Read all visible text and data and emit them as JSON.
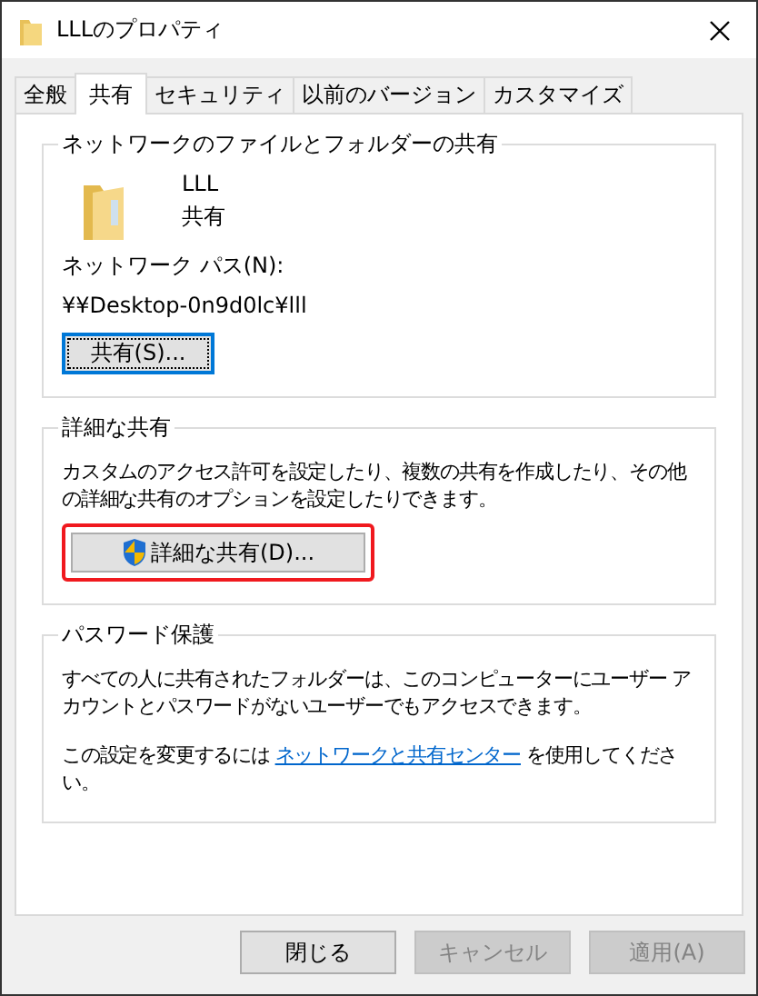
{
  "window": {
    "title": "LLLのプロパティ"
  },
  "tabs": [
    {
      "label": "全般",
      "selected": false
    },
    {
      "label": "共有",
      "selected": true
    },
    {
      "label": "セキュリティ",
      "selected": false
    },
    {
      "label": "以前のバージョン",
      "selected": false
    },
    {
      "label": "カスタマイズ",
      "selected": false
    }
  ],
  "network_sharing": {
    "title": "ネットワークのファイルとフォルダーの共有",
    "folder_name": "LLL",
    "folder_status": "共有",
    "path_label": "ネットワーク パス(N):",
    "path": "¥¥Desktop-0n9d0lc¥lll",
    "button": {
      "label": "共有(S)...",
      "focused": true
    }
  },
  "advanced_sharing": {
    "title": "詳細な共有",
    "description": "カスタムのアクセス許可を設定したり、複数の共有を作成したり、その他の詳細な共有のオプションを設定したりできます。",
    "button": {
      "label": "詳細な共有(D)...",
      "highlighted": true
    }
  },
  "password_protection": {
    "title": "パスワード保護",
    "description": "すべての人に共有されたフォルダーは、このコンピューターにユーザー アカウントとパスワードがないユーザーでもアクセスできます。",
    "link_prefix": "この設定を変更するには",
    "link": "ネットワークと共有センター",
    "link_suffix": "を使用してください。"
  },
  "buttons": [
    {
      "label": "閉じる",
      "disabled": false
    },
    {
      "label": "キャンセル",
      "disabled": true
    },
    {
      "label": "適用(A)",
      "disabled": true
    }
  ]
}
